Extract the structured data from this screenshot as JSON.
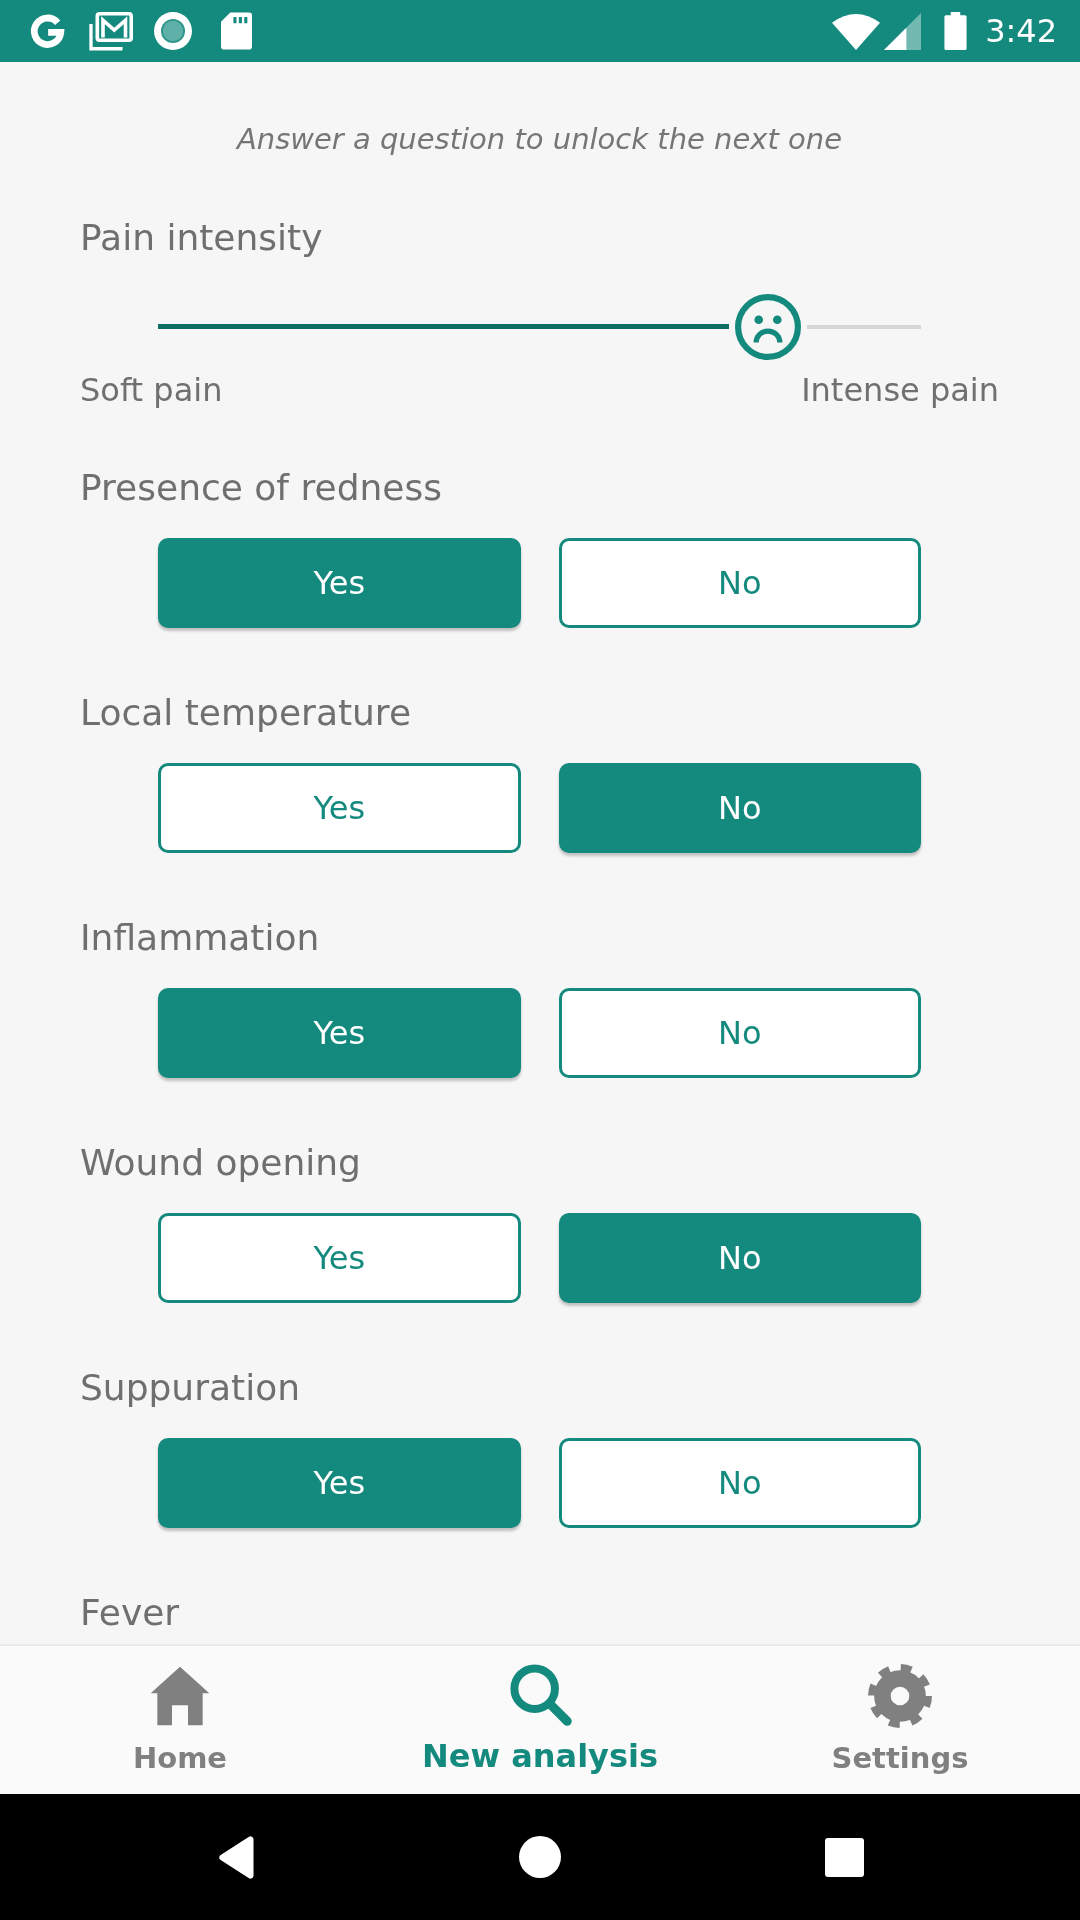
{
  "status_bar": {
    "time": "3:42"
  },
  "hint": "Answer a question to unlock the next one",
  "pain": {
    "label": "Pain intensity",
    "level": 0.8,
    "min_label": "Soft pain",
    "max_label": "Intense pain"
  },
  "questions": [
    {
      "label": "Presence of redness",
      "options": [
        {
          "label": "Yes",
          "selected": true
        },
        {
          "label": "No",
          "selected": false
        }
      ]
    },
    {
      "label": "Local temperature",
      "options": [
        {
          "label": "Yes",
          "selected": false
        },
        {
          "label": "No",
          "selected": true
        }
      ]
    },
    {
      "label": "Inflammation",
      "options": [
        {
          "label": "Yes",
          "selected": true
        },
        {
          "label": "No",
          "selected": false
        }
      ]
    },
    {
      "label": "Wound opening",
      "options": [
        {
          "label": "Yes",
          "selected": false
        },
        {
          "label": "No",
          "selected": true
        }
      ]
    },
    {
      "label": "Suppuration",
      "options": [
        {
          "label": "Yes",
          "selected": true
        },
        {
          "label": "No",
          "selected": false
        }
      ]
    },
    {
      "label": "Fever"
    }
  ],
  "bottom_nav": [
    {
      "label": "Home",
      "kind": "home",
      "selected": false
    },
    {
      "label": "New analysis",
      "kind": "search",
      "selected": true
    },
    {
      "label": "Settings",
      "kind": "settings",
      "selected": false
    }
  ]
}
